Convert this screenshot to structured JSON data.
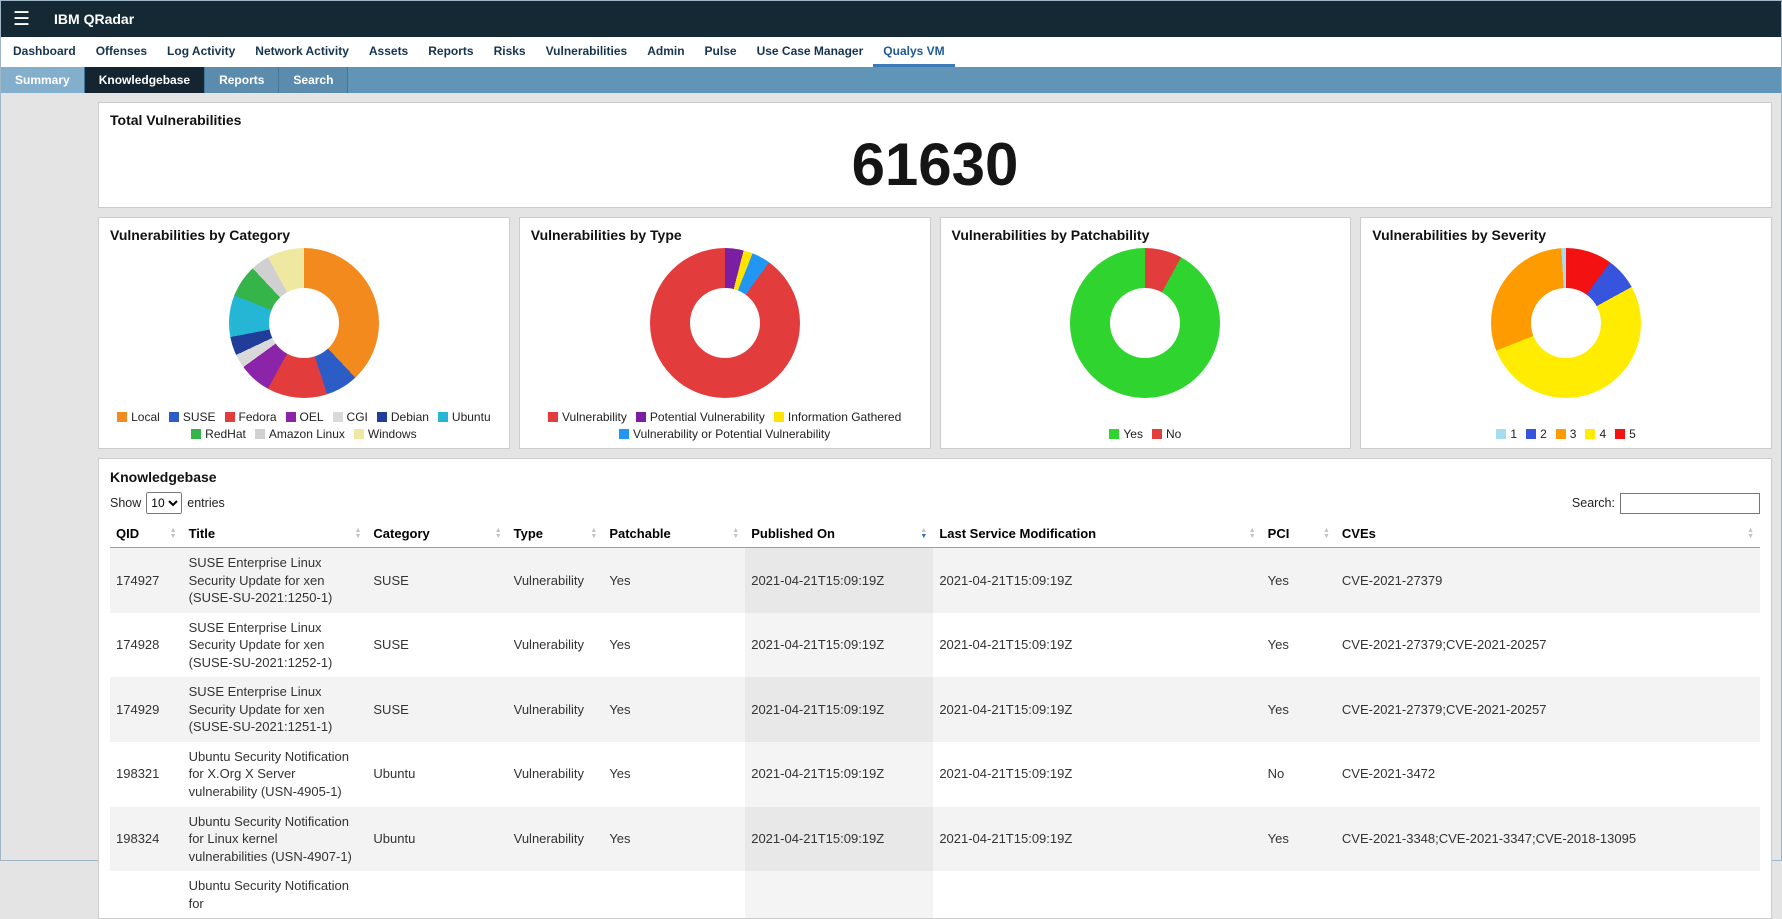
{
  "app": {
    "title": "IBM QRadar"
  },
  "nav": {
    "items": [
      "Dashboard",
      "Offenses",
      "Log Activity",
      "Network Activity",
      "Assets",
      "Reports",
      "Risks",
      "Vulnerabilities",
      "Admin",
      "Pulse",
      "Use Case Manager",
      "Qualys VM"
    ],
    "active": "Qualys VM"
  },
  "subnav": {
    "items": [
      "Summary",
      "Knowledgebase",
      "Reports",
      "Search"
    ],
    "active": "Knowledgebase"
  },
  "total_panel": {
    "title": "Total Vulnerabilities",
    "value": "61630"
  },
  "chart_data": [
    {
      "type": "pie",
      "title": "Vulnerabilities by Category",
      "legend_position": "bottom",
      "slices": [
        {
          "label": "Local",
          "value": 38,
          "color": "#f28a1e"
        },
        {
          "label": "SUSE",
          "value": 7,
          "color": "#2c5cc5"
        },
        {
          "label": "Fedora",
          "value": 13,
          "color": "#e23c3c"
        },
        {
          "label": "OEL",
          "value": 7,
          "color": "#8b24a8"
        },
        {
          "label": "CGI",
          "value": 3,
          "color": "#d9d9d9"
        },
        {
          "label": "Debian",
          "value": 4,
          "color": "#1f3d99"
        },
        {
          "label": "Ubuntu",
          "value": 9,
          "color": "#24b6d4"
        },
        {
          "label": "RedHat",
          "value": 7,
          "color": "#35b44a"
        },
        {
          "label": "Amazon Linux",
          "value": 4,
          "color": "#d0d0d0"
        },
        {
          "label": "Windows",
          "value": 8,
          "color": "#eee8a0"
        }
      ]
    },
    {
      "type": "pie",
      "title": "Vulnerabilities by Type",
      "legend_position": "bottom",
      "draw_order": [
        1,
        2,
        3,
        0
      ],
      "slices": [
        {
          "label": "Vulnerability",
          "value": 90,
          "color": "#e23c3c"
        },
        {
          "label": "Potential Vulnerability",
          "value": 4,
          "color": "#7b1fa2"
        },
        {
          "label": "Information Gathered",
          "value": 2,
          "color": "#ffe400"
        },
        {
          "label": "Vulnerability or Potential Vulnerability",
          "value": 4,
          "color": "#2196f3"
        }
      ]
    },
    {
      "type": "pie",
      "title": "Vulnerabilities by Patchability",
      "legend_position": "bottom",
      "draw_order": [
        1,
        0
      ],
      "slices": [
        {
          "label": "Yes",
          "value": 92,
          "color": "#2fd42f"
        },
        {
          "label": "No",
          "value": 8,
          "color": "#e23c3c"
        }
      ]
    },
    {
      "type": "pie",
      "title": "Vulnerabilities by Severity",
      "legend_position": "bottom",
      "draw_order": [
        4,
        1,
        3,
        2,
        0
      ],
      "slices": [
        {
          "label": "1",
          "value": 1,
          "color": "#a6dcef"
        },
        {
          "label": "2",
          "value": 7,
          "color": "#3654de"
        },
        {
          "label": "3",
          "value": 30,
          "color": "#fe9b00"
        },
        {
          "label": "4",
          "value": 52,
          "color": "#ffec00"
        },
        {
          "label": "5",
          "value": 10,
          "color": "#f31111"
        }
      ]
    }
  ],
  "knowledgebase": {
    "title": "Knowledgebase",
    "show_label": "Show",
    "page_size": "10",
    "entries_label": "entries",
    "search_label": "Search:",
    "columns": [
      {
        "key": "qid",
        "label": "QID"
      },
      {
        "key": "title",
        "label": "Title"
      },
      {
        "key": "category",
        "label": "Category"
      },
      {
        "key": "type",
        "label": "Type"
      },
      {
        "key": "patchable",
        "label": "Patchable"
      },
      {
        "key": "published",
        "label": "Published On",
        "sorted": true
      },
      {
        "key": "modified",
        "label": "Last Service Modification"
      },
      {
        "key": "pci",
        "label": "PCI"
      },
      {
        "key": "cves",
        "label": "CVEs"
      }
    ],
    "rows": [
      {
        "qid": "174927",
        "title": "SUSE Enterprise Linux Security Update for xen (SUSE-SU-2021:1250-1)",
        "category": "SUSE",
        "type": "Vulnerability",
        "patchable": "Yes",
        "published": "2021-04-21T15:09:19Z",
        "modified": "2021-04-21T15:09:19Z",
        "pci": "Yes",
        "cves": "CVE-2021-27379"
      },
      {
        "qid": "174928",
        "title": "SUSE Enterprise Linux Security Update for xen (SUSE-SU-2021:1252-1)",
        "category": "SUSE",
        "type": "Vulnerability",
        "patchable": "Yes",
        "published": "2021-04-21T15:09:19Z",
        "modified": "2021-04-21T15:09:19Z",
        "pci": "Yes",
        "cves": "CVE-2021-27379;CVE-2021-20257"
      },
      {
        "qid": "174929",
        "title": "SUSE Enterprise Linux Security Update for xen (SUSE-SU-2021:1251-1)",
        "category": "SUSE",
        "type": "Vulnerability",
        "patchable": "Yes",
        "published": "2021-04-21T15:09:19Z",
        "modified": "2021-04-21T15:09:19Z",
        "pci": "Yes",
        "cves": "CVE-2021-27379;CVE-2021-20257"
      },
      {
        "qid": "198321",
        "title": "Ubuntu Security Notification for X.Org X Server vulnerability (USN-4905-1)",
        "category": "Ubuntu",
        "type": "Vulnerability",
        "patchable": "Yes",
        "published": "2021-04-21T15:09:19Z",
        "modified": "2021-04-21T15:09:19Z",
        "pci": "No",
        "cves": "CVE-2021-3472"
      },
      {
        "qid": "198324",
        "title": "Ubuntu Security Notification for Linux kernel vulnerabilities (USN-4907-1)",
        "category": "Ubuntu",
        "type": "Vulnerability",
        "patchable": "Yes",
        "published": "2021-04-21T15:09:19Z",
        "modified": "2021-04-21T15:09:19Z",
        "pci": "Yes",
        "cves": "CVE-2021-3348;CVE-2021-3347;CVE-2018-13095"
      },
      {
        "qid": "",
        "title": "Ubuntu Security Notification for",
        "category": "",
        "type": "",
        "patchable": "",
        "published": "",
        "modified": "",
        "pci": "",
        "cves": ""
      }
    ]
  }
}
